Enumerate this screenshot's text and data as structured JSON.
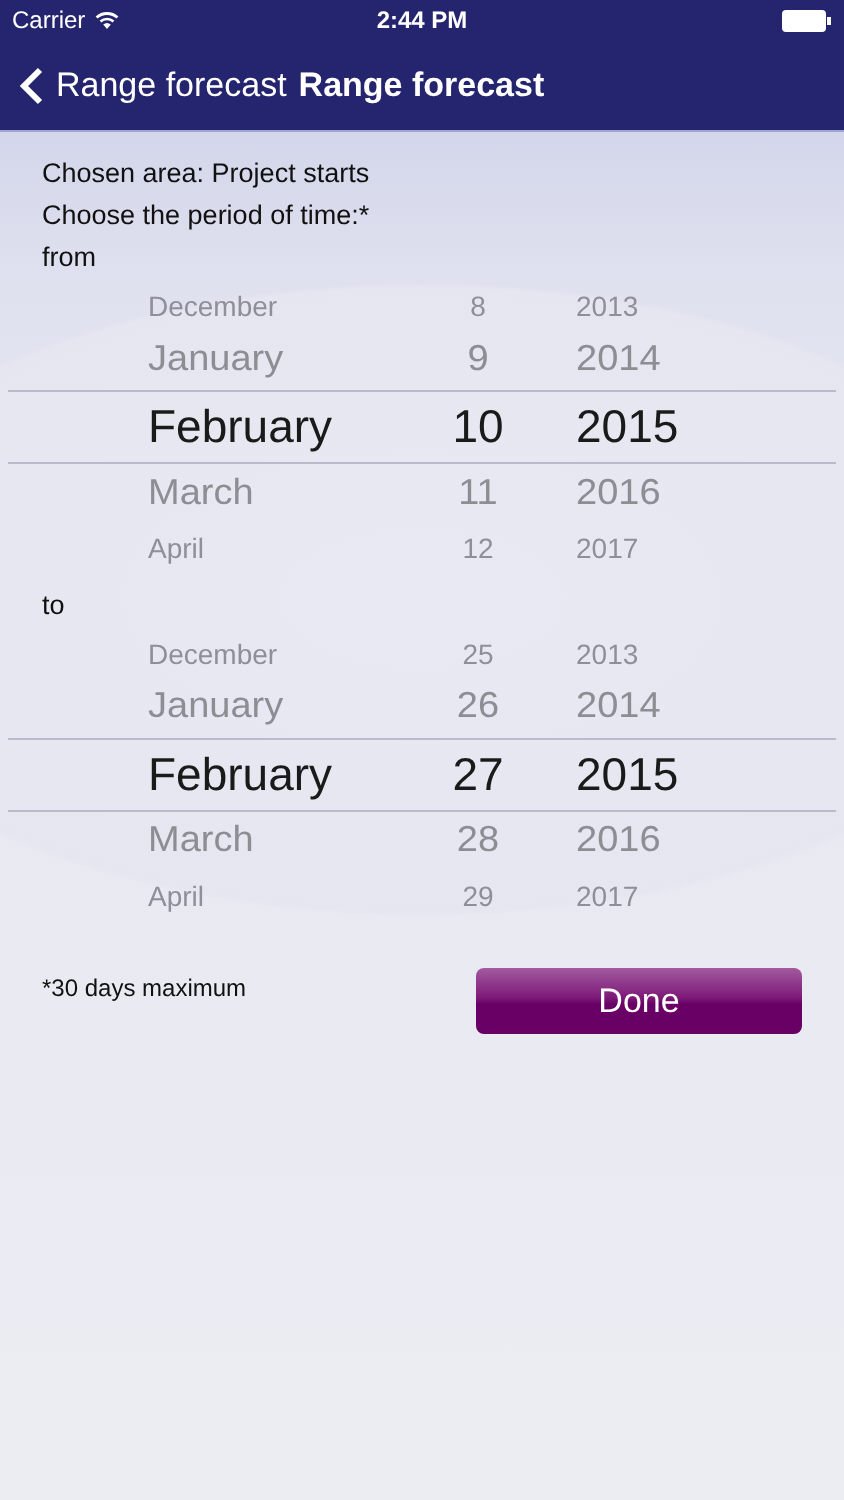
{
  "status_bar": {
    "carrier": "Carrier",
    "time": "2:44 PM"
  },
  "nav_bar": {
    "back_label": "Range forecast",
    "title": "Range forecast"
  },
  "intro": [
    "Chosen area: Project starts",
    "Choose the period of time:*"
  ],
  "pickers": [
    {
      "label": "from",
      "rows": [
        {
          "month": "December",
          "day": "8",
          "year": "2013",
          "selected": false
        },
        {
          "month": "January",
          "day": "9",
          "year": "2014",
          "selected": false
        },
        {
          "month": "February",
          "day": "10",
          "year": "2015",
          "selected": true
        },
        {
          "month": "March",
          "day": "11",
          "year": "2016",
          "selected": false
        },
        {
          "month": "April",
          "day": "12",
          "year": "2017",
          "selected": false
        }
      ]
    },
    {
      "label": "to",
      "rows": [
        {
          "month": "December",
          "day": "25",
          "year": "2013",
          "selected": false
        },
        {
          "month": "January",
          "day": "26",
          "year": "2014",
          "selected": false
        },
        {
          "month": "February",
          "day": "27",
          "year": "2015",
          "selected": true
        },
        {
          "month": "March",
          "day": "28",
          "year": "2016",
          "selected": false
        },
        {
          "month": "April",
          "day": "29",
          "year": "2017",
          "selected": false
        }
      ]
    }
  ],
  "footnote": "*30 days maximum",
  "done_button": "Done"
}
